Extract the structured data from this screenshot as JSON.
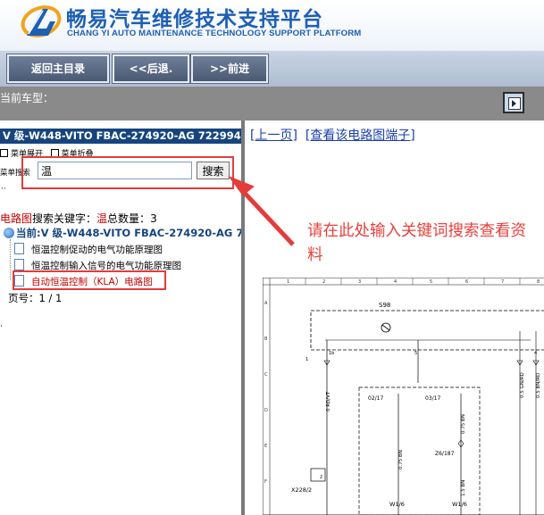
{
  "header": {
    "title": "畅易汽车维修技术支持平台",
    "subtitle": "CHANG YI AUTO MAINTENANCE TECHNOLOGY SUPPORT PLATFORM",
    "brand_color": "#1d5fb3"
  },
  "nav": {
    "home_label": "返回主目录",
    "back_label": "<<后退.",
    "forward_label": ">>前进"
  },
  "model_bar": {
    "label": "当前车型："
  },
  "sidebar": {
    "vehicle_title": "V 级-W448-VITO FBAC-274920-AG 722994",
    "expand_menu": "菜单展开",
    "collapse_menu": "菜单折叠",
    "search_label": "菜单搜索",
    "search_value": "温",
    "search_button": "搜索",
    "result_category": "电路图",
    "result_keyword_label": "搜索关键字：",
    "result_keyword": "温",
    "result_total_label": "总数量：",
    "result_total": "3",
    "tree_root": "当前:V 级-W448-VITO FBAC-274920-AG 7",
    "items": [
      {
        "label": "恒温控制促动的电气功能原理图"
      },
      {
        "label": "恒温控制输入信号的电气功能原理图"
      },
      {
        "label": "自动恒温控制（KLA）电路图"
      }
    ],
    "page_label": "页号：",
    "page_value": "1 / 1"
  },
  "content": {
    "prev_link": "[上一页]",
    "view_terminals_link": "[查看该电路图端子]",
    "annotation": "请在此处输入关键词搜索查看资料",
    "annotation_color": "#e8403c"
  },
  "diagram": {
    "col_numbers": [
      "1",
      "2",
      "3",
      "4",
      "5",
      "6",
      "7",
      "8"
    ],
    "row_letters": [
      "A",
      "B",
      "C",
      "D",
      "E",
      "F"
    ],
    "component_top": "S98",
    "pin_1": "1",
    "pin_1b": "1b",
    "pin_5": "5",
    "pin_4": "4",
    "wire_1": "0 RD/VT",
    "wire_2": "0.75 BN",
    "wire_3": "0.75 BN",
    "wire_4": "0.5 GN/RD",
    "wire_5": "0.5 BN/RD",
    "wire_6": "1.5 BN",
    "conn_1": "02/17",
    "conn_2": "03/17",
    "splice": "Z6/187",
    "connector": "X228/2",
    "pin_2": "2",
    "ground_1": "W1/6",
    "ground_2": "W1/6"
  }
}
